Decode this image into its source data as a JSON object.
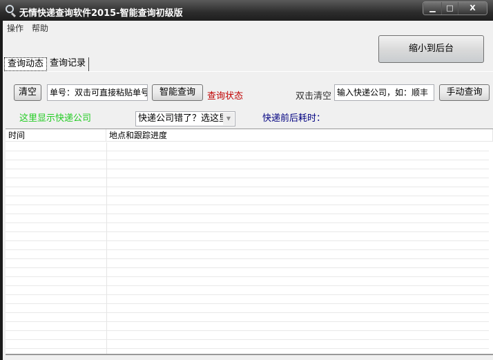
{
  "window": {
    "title": "无情快递查询软件2015-智能查询初级版",
    "minimize": "▁",
    "maximize": "□",
    "close": "X"
  },
  "menu": [
    "操作",
    "帮助"
  ],
  "minimize_to_tray": "缩小到后台",
  "tabs": [
    "查询动态",
    "查询记录"
  ],
  "controls": {
    "clear": "清空",
    "tracking_input": "单号：双击可直接粘贴单号",
    "smart_query": "智能查询",
    "query_status": "查询状态",
    "dblclick_clear": "双击清空",
    "company_input": "输入快递公司，如：顺丰",
    "manual_query": "手动查询",
    "company_display": "这里显示快递公司",
    "company_select": "快递公司错了？选这里",
    "elapsed": "快递前后耗时："
  },
  "colors": {
    "status": "#c00000",
    "company": "#22cc22",
    "elapsed": "#000080"
  },
  "list": {
    "columns": [
      "时间",
      "地点和跟踪进度"
    ]
  }
}
